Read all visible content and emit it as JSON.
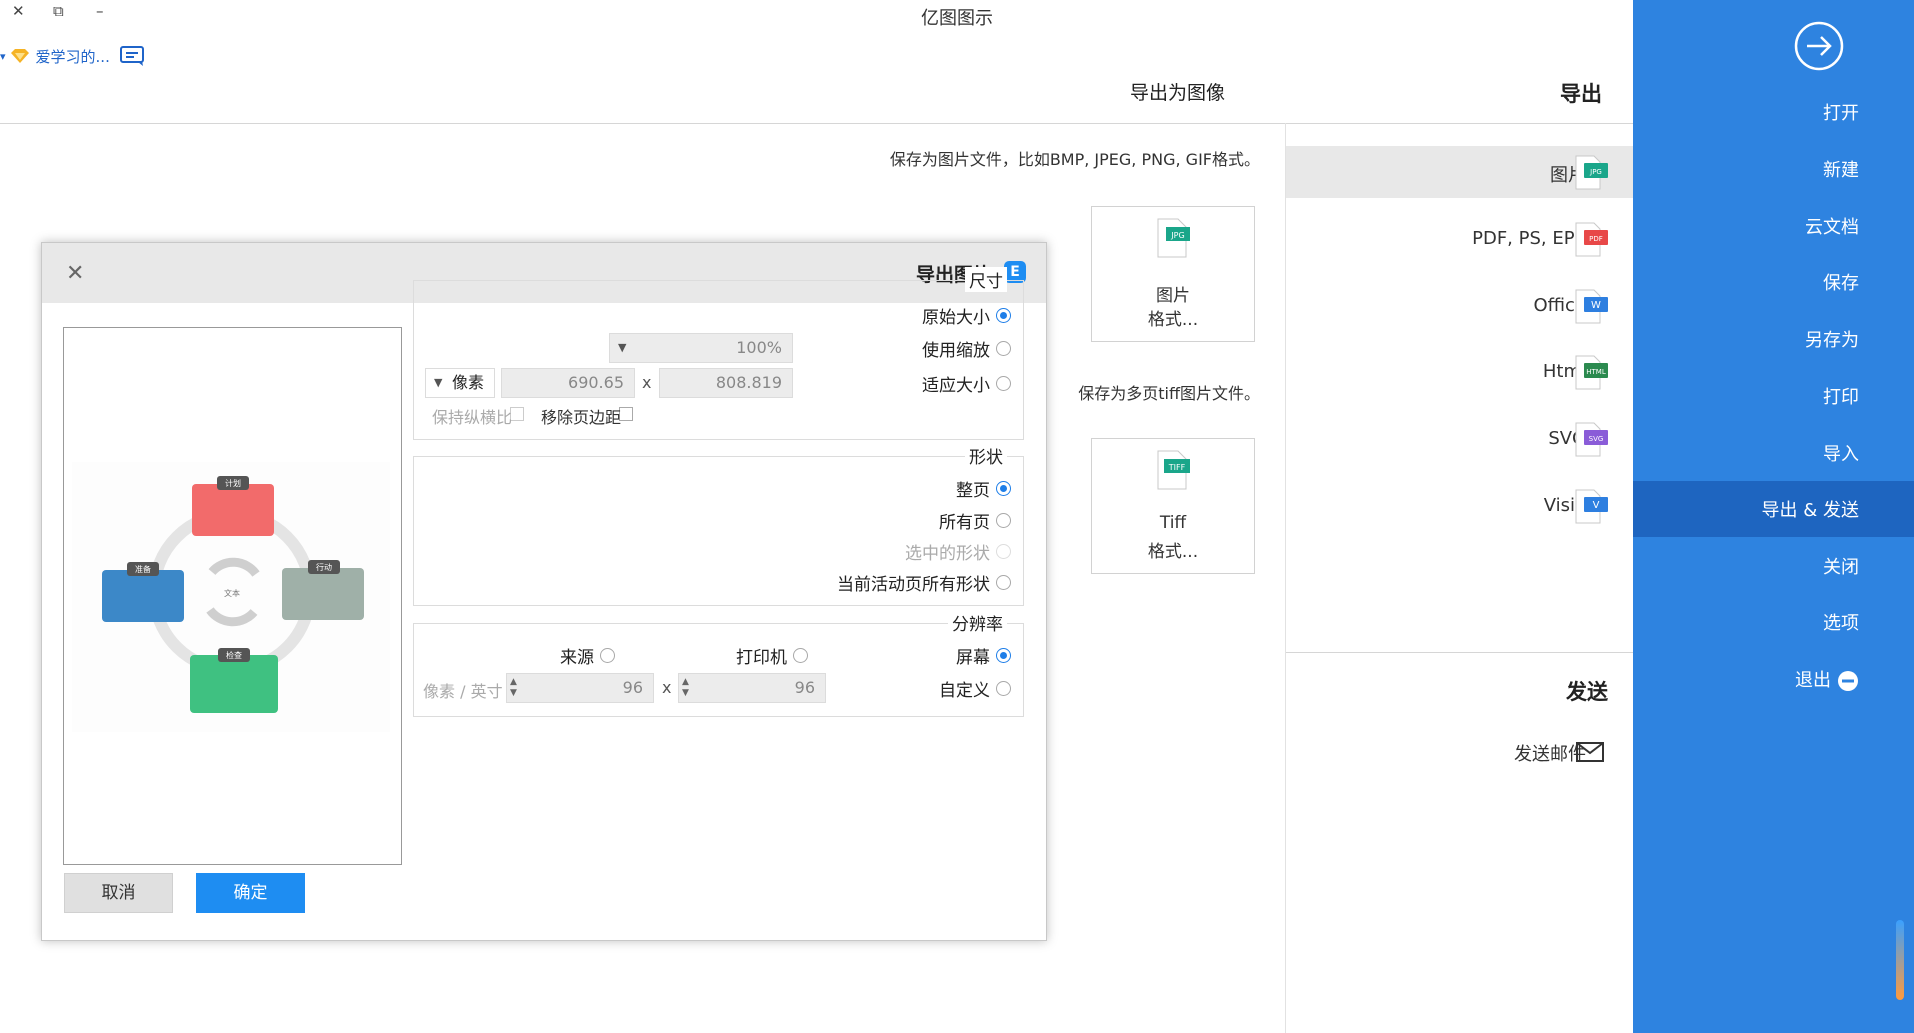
{
  "window": {
    "title": "亿图图示",
    "controls": {
      "close": "✕",
      "restore": "⧉",
      "minimize": "–"
    }
  },
  "user": {
    "name": "爱学习的...",
    "dropdown": "▾"
  },
  "header": {
    "export_heading": "导出",
    "panel_title": "导出为图像"
  },
  "content": {
    "image_description": "保存为图片文件，比如BMP, JPEG, PNG, GIF格式。",
    "tiff_description": "保存为多页tiff图片文件。",
    "image_card": {
      "line1": "图片",
      "line2": "格式..."
    },
    "tiff_card": {
      "line1": "Tiff",
      "line2": "格式..."
    }
  },
  "export_types": [
    {
      "label": "图片",
      "icon": "jpg-icon",
      "tag": "JPG",
      "color": "#1aa68a"
    },
    {
      "label": "PDF, PS, EPS",
      "icon": "pdf-icon",
      "tag": "PDF",
      "color": "#e84848"
    },
    {
      "label": "Office",
      "icon": "word-icon",
      "tag": "W",
      "color": "#2e7fe0"
    },
    {
      "label": "Html",
      "icon": "html-icon",
      "tag": "HTML",
      "color": "#2b8a4f"
    },
    {
      "label": "SVG",
      "icon": "svg-icon",
      "tag": "SVG",
      "color": "#8a5cd8"
    },
    {
      "label": "Visio",
      "icon": "visio-icon",
      "tag": "V",
      "color": "#2e7fe0"
    }
  ],
  "send": {
    "heading": "发送",
    "mail_label": "发送邮件"
  },
  "sidebar": {
    "items": [
      {
        "label": "打开"
      },
      {
        "label": "新建"
      },
      {
        "label": "云文档"
      },
      {
        "label": "保存"
      },
      {
        "label": "另存为"
      },
      {
        "label": "打印"
      },
      {
        "label": "导入"
      },
      {
        "label": "导出 & 发送"
      },
      {
        "label": "关闭"
      },
      {
        "label": "选项"
      },
      {
        "label": "退出"
      }
    ]
  },
  "dialog": {
    "title": "导出图片",
    "logo": "E",
    "size": {
      "title": "尺寸",
      "original": "原始大小",
      "zoom": "使用缩放",
      "zoom_value": "100%",
      "fit": "适应大小",
      "width": "808.819",
      "height": "690.65",
      "times": "x",
      "unit": "像素",
      "remove_margin": "移除页边距",
      "keep_ratio": "保持纵横比"
    },
    "shape": {
      "title": "形状",
      "whole_page": "整页",
      "all_pages": "所有页",
      "selected": "选中的形状",
      "current_page": "当前活动页所有形状"
    },
    "resolution": {
      "title": "分辨率",
      "screen": "屏幕",
      "printer": "打印机",
      "source": "来源",
      "custom": "自定义",
      "dpi_x": "96",
      "dpi_y": "96",
      "times": "x",
      "unit": "像素 / 英寸"
    },
    "buttons": {
      "ok": "确定",
      "cancel": "取消"
    },
    "preview": {
      "center": "文本",
      "top_tag": "计划",
      "right_tag": "行动",
      "bottom_tag": "检查",
      "left_tag": "准备",
      "colors": {
        "top": "#f26b6b",
        "right": "#9fb0a8",
        "bottom": "#3fc181",
        "left": "#3c88c8"
      }
    }
  },
  "colors": {
    "sidebar": "#2e83e0",
    "sidebar_selected": "#1e65c0",
    "primary": "#1e8df2"
  }
}
